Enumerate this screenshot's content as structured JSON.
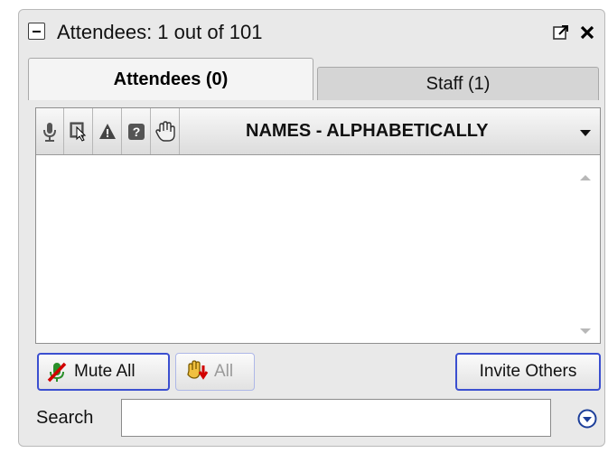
{
  "window": {
    "title": "Attendees:  1 out of 101"
  },
  "tabs": [
    {
      "label": "Attendees (0)",
      "active": true
    },
    {
      "label": "Staff (1)",
      "active": false
    }
  ],
  "list": {
    "header_icons": [
      "microphone-icon",
      "screen-share-icon",
      "warning-icon",
      "question-icon",
      "raise-hand-icon"
    ],
    "sort_label": "NAMES - ALPHABETICALLY",
    "items": []
  },
  "actions": {
    "mute_all_label": "Mute All",
    "lower_hands_label": "All",
    "invite_label": "Invite Others"
  },
  "search": {
    "label": "Search",
    "value": ""
  },
  "colors": {
    "button_border_active": "#3b4fd0",
    "panel_bg": "#e9e9e9"
  }
}
